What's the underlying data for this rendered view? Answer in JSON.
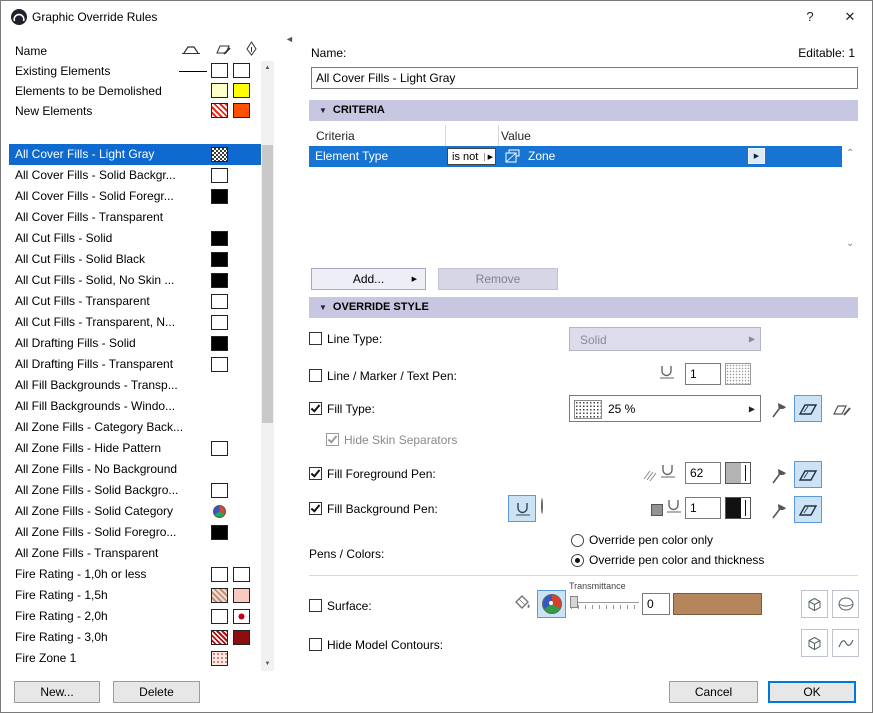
{
  "window": {
    "title": "Graphic Override Rules",
    "help_label": "?",
    "close_label": "✕"
  },
  "accent": {
    "selection_blue": "#0f6ad0",
    "section_lavender": "#c7c7e2",
    "pressed_blue": "#cce3f6",
    "surface_brown": "#b5855c"
  },
  "list": {
    "header_name": "Name",
    "predefined": [
      {
        "label": "Existing Elements",
        "swatches": [
          "line",
          "white",
          "white"
        ]
      },
      {
        "label": "Elements to be Demolished",
        "swatches": [
          "none",
          "yellow-light",
          "yellow"
        ]
      },
      {
        "label": "New Elements",
        "swatches": [
          "none",
          "red-hatch",
          "orange"
        ]
      }
    ],
    "rules": [
      {
        "label": "All Cover Fills - Light Gray",
        "selected": true,
        "swatches": [
          "checker"
        ]
      },
      {
        "label": "All Cover Fills - Solid Backgr...",
        "selected": false,
        "swatches": [
          "white"
        ]
      },
      {
        "label": "All Cover Fills - Solid Foregr...",
        "selected": false,
        "swatches": [
          "black"
        ]
      },
      {
        "label": "All Cover Fills - Transparent",
        "selected": false,
        "swatches": []
      },
      {
        "label": "All Cut Fills - Solid",
        "selected": false,
        "swatches": [
          "black"
        ]
      },
      {
        "label": "All Cut Fills - Solid Black",
        "selected": false,
        "swatches": [
          "black"
        ]
      },
      {
        "label": "All Cut Fills - Solid, No Skin ...",
        "selected": false,
        "swatches": [
          "black"
        ]
      },
      {
        "label": "All Cut Fills - Transparent",
        "selected": false,
        "swatches": [
          "white"
        ]
      },
      {
        "label": "All Cut Fills - Transparent, N...",
        "selected": false,
        "swatches": [
          "white"
        ]
      },
      {
        "label": "All Drafting Fills - Solid",
        "selected": false,
        "swatches": [
          "black"
        ]
      },
      {
        "label": "All Drafting Fills - Transparent",
        "selected": false,
        "swatches": [
          "white"
        ]
      },
      {
        "label": "All Fill Backgrounds - Transp...",
        "selected": false,
        "swatches": []
      },
      {
        "label": "All Fill Backgrounds - Windo...",
        "selected": false,
        "swatches": []
      },
      {
        "label": "All Zone Fills - Category Back...",
        "selected": false,
        "swatches": []
      },
      {
        "label": "All Zone Fills - Hide Pattern",
        "selected": false,
        "swatches": [
          "white"
        ]
      },
      {
        "label": "All Zone Fills - No Background",
        "selected": false,
        "swatches": []
      },
      {
        "label": "All Zone Fills - Solid Backgro...",
        "selected": false,
        "swatches": [
          "white"
        ]
      },
      {
        "label": "All Zone Fills - Solid Category",
        "selected": false,
        "swatches": [
          "pie"
        ]
      },
      {
        "label": "All Zone Fills - Solid Foregro...",
        "selected": false,
        "swatches": [
          "black"
        ]
      },
      {
        "label": "All Zone Fills - Transparent",
        "selected": false,
        "swatches": []
      },
      {
        "label": "Fire Rating - 1,0h or less",
        "selected": false,
        "swatches": [
          "white",
          "white"
        ]
      },
      {
        "label": "Fire Rating - 1,5h",
        "selected": false,
        "swatches": [
          "pink-hatch",
          "pink"
        ]
      },
      {
        "label": "Fire Rating - 2,0h",
        "selected": false,
        "swatches": [
          "white",
          "red-dot"
        ]
      },
      {
        "label": "Fire Rating - 3,0h",
        "selected": false,
        "swatches": [
          "darkred-hatch",
          "darkred"
        ]
      },
      {
        "label": "Fire Zone 1",
        "selected": false,
        "swatches": [
          "pink-dots"
        ]
      }
    ],
    "new_button": "New...",
    "delete_button": "Delete"
  },
  "editor": {
    "name_label": "Name:",
    "editable_label": "Editable: 1",
    "name_value": "All Cover Fills - Light Gray",
    "criteria": {
      "title": "CRITERIA",
      "col_criteria": "Criteria",
      "col_value": "Value",
      "row": {
        "field": "Element Type",
        "operator": "is not",
        "value": "Zone"
      },
      "add_button": "Add...",
      "remove_button": "Remove"
    },
    "override": {
      "title": "OVERRIDE STYLE",
      "line_type_label": "Line Type:",
      "line_type_value": "Solid",
      "line_pen_label": "Line / Marker / Text Pen:",
      "line_pen_value": "1",
      "fill_type_label": "Fill Type:",
      "fill_type_value": "25 %",
      "hide_skin_label": "Hide Skin Separators",
      "fill_fg_label": "Fill Foreground Pen:",
      "fill_fg_value": "62",
      "fill_bg_label": "Fill Background Pen:",
      "fill_bg_value": "1",
      "pens_label": "Pens / Colors:",
      "radio_color_only": "Override pen color only",
      "radio_color_thickness": "Override pen color and thickness",
      "surface_label": "Surface:",
      "transmittance_label": "Transmittance",
      "transmittance_value": "0",
      "hide_contours_label": "Hide Model Contours:"
    },
    "cancel_button": "Cancel",
    "ok_button": "OK"
  }
}
